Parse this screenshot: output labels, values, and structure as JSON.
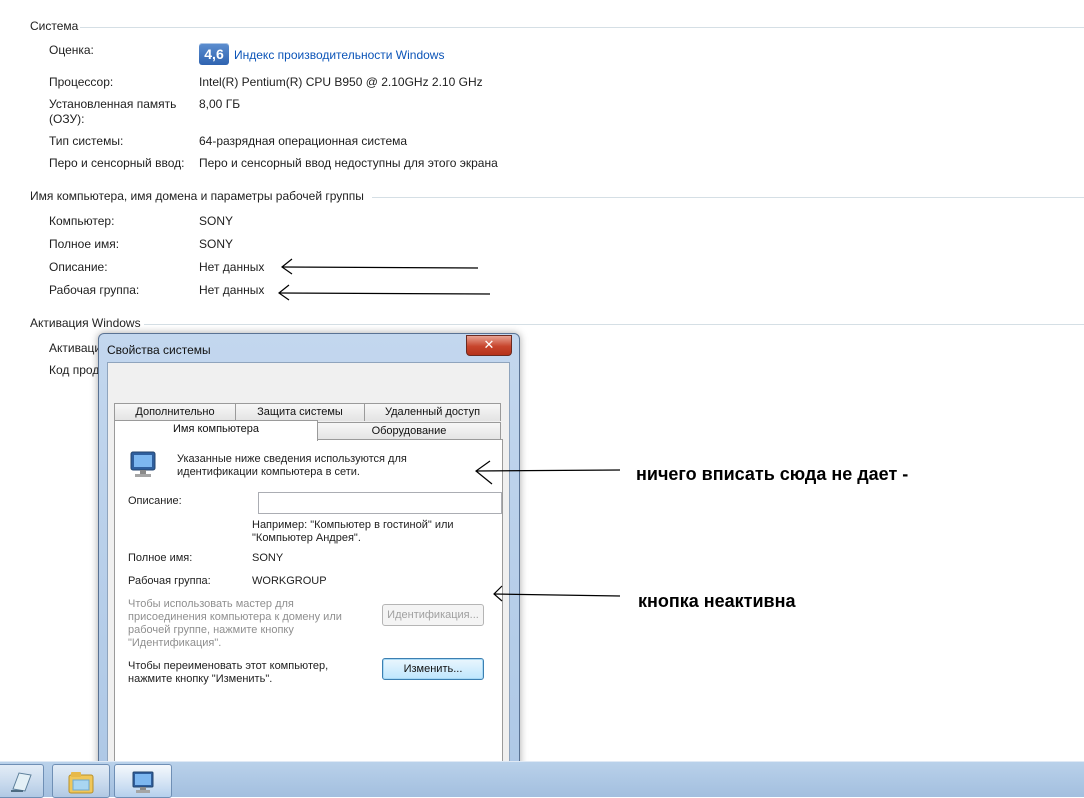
{
  "system": {
    "title": "Система",
    "rating_label": "Оценка:",
    "rating_value": "4,6",
    "rating_link": "Индекс производительности Windows",
    "cpu_label": "Процессор:",
    "cpu_value": "Intel(R) Pentium(R) CPU B950 @ 2.10GHz   2.10 GHz",
    "ram_label_1": "Установленная память",
    "ram_label_2": "(ОЗУ):",
    "ram_value": "8,00 ГБ",
    "type_label": "Тип системы:",
    "type_value": "64-разрядная операционная система",
    "pen_label": "Перо и сенсорный ввод:",
    "pen_value": "Перо и сенсорный ввод недоступны для этого экрана"
  },
  "computer": {
    "title": "Имя компьютера, имя домена и параметры рабочей группы",
    "name_label": "Компьютер:",
    "name_value": "SONY",
    "full_label": "Полное имя:",
    "full_value": "SONY",
    "desc_label": "Описание:",
    "desc_value": "Нет данных",
    "wg_label": "Рабочая группа:",
    "wg_value": "Нет данных"
  },
  "activation": {
    "title": "Активация Windows",
    "row1_label": "Активаци",
    "row2_label": "Код прод"
  },
  "dialog": {
    "title": "Свойства системы",
    "close": "✕",
    "tabs": {
      "advanced": "Дополнительно",
      "protection": "Защита системы",
      "remote": "Удаленный доступ",
      "computer_name": "Имя компьютера",
      "hardware": "Оборудование"
    },
    "intro_1": "Указанные ниже сведения используются для",
    "intro_2": "идентификации компьютера в сети.",
    "desc_label": "Описание:",
    "desc_value": "",
    "example_1": "Например: \"Компьютер в гостиной\" или",
    "example_2": "\"Компьютер Андрея\".",
    "full_label": "Полное имя:",
    "full_value": "SONY",
    "wg_label": "Рабочая группа:",
    "wg_value": "WORKGROUP",
    "wizard_1": "Чтобы использовать мастер для",
    "wizard_2": "присоединения компьютера к домену или",
    "wizard_3": "рабочей группе, нажмите кнопку",
    "wizard_4": "\"Идентификация\".",
    "network_id_button": "Идентификация...",
    "rename_1": "Чтобы переименовать этот компьютер,",
    "rename_2": "нажмите кнопку \"Изменить\".",
    "change_button": "Изменить..."
  },
  "annotations": {
    "note_1": "ничего вписать сюда не дает -",
    "note_2": "кнопка неактивна"
  },
  "taskbar": {
    "items": [
      "notepad-icon",
      "explorer-icon",
      "system-properties-icon"
    ]
  }
}
